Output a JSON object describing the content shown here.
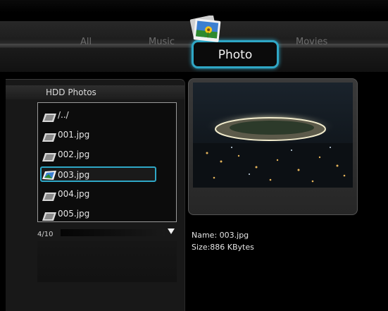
{
  "categories": {
    "all_label": "All",
    "music_label": "Music",
    "photo_label": "Photo",
    "movies_label": "Movies"
  },
  "browser": {
    "title": "HDD Photos",
    "items": [
      {
        "label": "/../"
      },
      {
        "label": "001.jpg"
      },
      {
        "label": "002.jpg"
      },
      {
        "label": "003.jpg"
      },
      {
        "label": "004.jpg"
      },
      {
        "label": "005.jpg"
      }
    ],
    "selected_index": 3,
    "counter": "4/10"
  },
  "preview": {
    "name_text": "Name: 003.jpg",
    "size_text": "Size:886 KBytes"
  },
  "colors": {
    "accent": "#2fa7c6"
  },
  "icons": {
    "photo_category": "photo-album-icon",
    "scroll": "triangle-down-icon",
    "file": "image-file-icon"
  }
}
